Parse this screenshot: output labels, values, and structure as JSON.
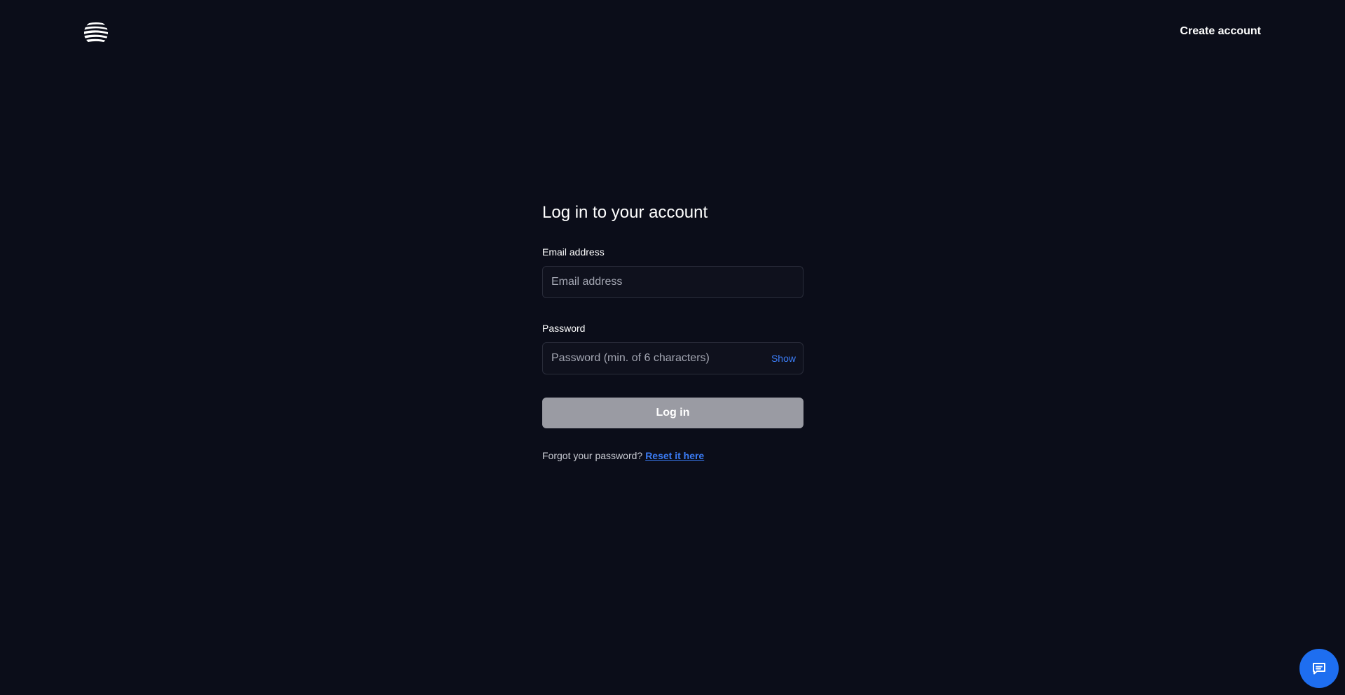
{
  "header": {
    "logo_icon": "striped-globe-logo",
    "create_account_label": "Create account"
  },
  "login_form": {
    "title": "Log in to your account",
    "email": {
      "label": "Email address",
      "placeholder": "Email address",
      "value": ""
    },
    "password": {
      "label": "Password",
      "placeholder": "Password (min. of 6 characters)",
      "value": "",
      "toggle_label": "Show"
    },
    "submit_label": "Log in",
    "forgot_text": "Forgot your password?",
    "reset_link_label": "Reset it here"
  },
  "chat_widget": {
    "icon": "chat-bubble-icon"
  },
  "colors": {
    "background": "#0b0d19",
    "accent": "#3b7cf5",
    "chat_button": "#1e6ef0",
    "disabled_button": "#9a9ba3"
  }
}
